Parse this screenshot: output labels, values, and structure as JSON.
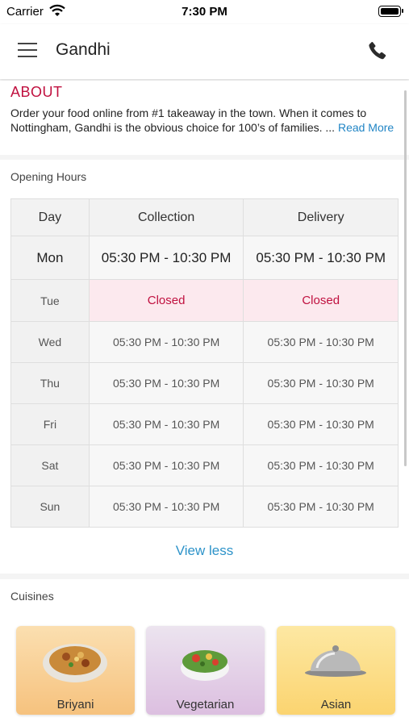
{
  "status_bar": {
    "carrier": "Carrier",
    "time": "7:30 PM"
  },
  "header": {
    "title": "Gandhi",
    "menu_icon": "hamburger-menu-icon",
    "call_icon": "phone-icon"
  },
  "about": {
    "title": "ABOUT",
    "text": "Order your food online from #1 takeaway in the town. When it comes to Nottingham, Gandhi is the obvious choice for 100’s of families. ...",
    "read_more": "Read More"
  },
  "opening_hours": {
    "title": "Opening Hours",
    "columns": [
      "Day",
      "Collection",
      "Delivery"
    ],
    "rows": [
      {
        "day": "Mon",
        "collection": "05:30 PM - 10:30 PM",
        "delivery": "05:30 PM - 10:30 PM"
      },
      {
        "day": "Tue",
        "collection": "Closed",
        "delivery": "Closed"
      },
      {
        "day": "Wed",
        "collection": "05:30 PM - 10:30 PM",
        "delivery": "05:30 PM - 10:30 PM"
      },
      {
        "day": "Thu",
        "collection": "05:30 PM - 10:30 PM",
        "delivery": "05:30 PM - 10:30 PM"
      },
      {
        "day": "Fri",
        "collection": "05:30 PM - 10:30 PM",
        "delivery": "05:30 PM - 10:30 PM"
      },
      {
        "day": "Sat",
        "collection": "05:30 PM - 10:30 PM",
        "delivery": "05:30 PM - 10:30 PM"
      },
      {
        "day": "Sun",
        "collection": "05:30 PM - 10:30 PM",
        "delivery": "05:30 PM - 10:30 PM"
      }
    ],
    "view_less": "View less"
  },
  "cuisines": {
    "title": "Cuisines",
    "items": [
      {
        "label": "Briyani",
        "icon": "biryani-plate-icon"
      },
      {
        "label": "Vegetarian",
        "icon": "salad-bowl-icon"
      },
      {
        "label": "Asian",
        "icon": "cloche-icon"
      }
    ]
  },
  "colors": {
    "accent_red": "#c0103f",
    "link_blue": "#2185c5",
    "closed_bg": "#fce9ee"
  }
}
